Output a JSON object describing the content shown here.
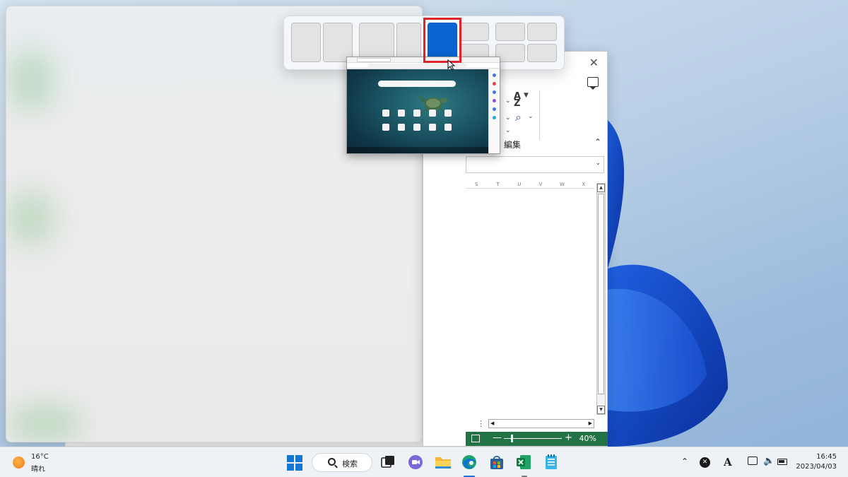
{
  "excel": {
    "group_label": "編集",
    "columns": [
      "S",
      "T",
      "U",
      "V",
      "W",
      "X"
    ],
    "zoom_label": "40%",
    "close_glyph": "✕",
    "collapse_glyph": "⌃",
    "sort_glyph": "A\nZ",
    "find_glyph": "⌕",
    "status_minus": "—",
    "status_plus": "+"
  },
  "snap_layouts": {
    "active_zone_color": "#0a64d2",
    "highlight_color": "#e0232b"
  },
  "taskbar": {
    "weather": {
      "temp": "16°C",
      "condition": "晴れ"
    },
    "search_label": "検索",
    "clock": {
      "time": "16:45",
      "date": "2023/04/03"
    },
    "tray_chevron": "⌃"
  },
  "icons": {
    "start": "windows-logo-icon",
    "taskview": "task-view-icon",
    "chat": "teams-chat-icon",
    "explorer": "file-explorer-icon",
    "edge": "edge-icon",
    "store": "microsoft-store-icon",
    "excel": "excel-icon",
    "notepad": "notepad-icon"
  },
  "colors": {
    "accent": "#1477d4",
    "excel_green": "#217346"
  }
}
